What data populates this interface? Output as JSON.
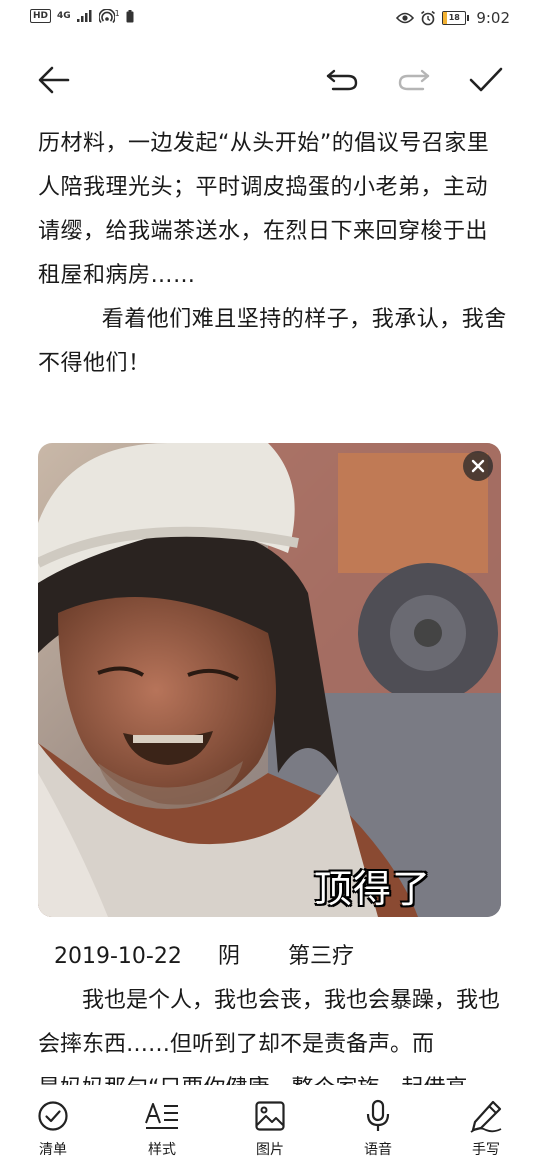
{
  "status_bar": {
    "network": "4G",
    "sim_label": "1",
    "hd": "HD",
    "battery": "18",
    "battery_level": 0.18,
    "time": "9:02"
  },
  "toolbar": {
    "back_icon": "arrow-left-icon",
    "undo_icon": "undo-icon",
    "redo_icon": "redo-icon",
    "done_icon": "check-icon"
  },
  "editor": {
    "paragraph_1": "历材料，一边发起“从头开始”的倡议号召家里人陪我理光头；平时调皮捣蛋的小老弟，主动请缨，给我端茶送水，在烈日下来回穿梭于出租屋和病房……",
    "paragraph_2": "看着他们难且坚持的样子，我承认，我舍不得他们！"
  },
  "image": {
    "caption": "顶得了",
    "close_icon": "close-icon"
  },
  "diary": {
    "date": "2019-10-22",
    "weather": "阴",
    "title": "第三疗",
    "paragraph_1": "我也是个人，我也会丧，我也会暴躁，我也会摔东西……但听到了却不是责备声。而",
    "paragraph_cut": "是妈妈那句“只要你健康，整个家族一起借高"
  },
  "bottom_bar": {
    "items": [
      {
        "label": "清单",
        "icon": "checklist-icon"
      },
      {
        "label": "样式",
        "icon": "text-style-icon"
      },
      {
        "label": "图片",
        "icon": "image-icon"
      },
      {
        "label": "语音",
        "icon": "microphone-icon"
      },
      {
        "label": "手写",
        "icon": "handwriting-icon"
      }
    ]
  }
}
